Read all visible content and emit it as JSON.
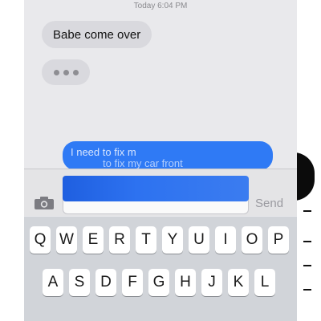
{
  "status": {
    "timestamp": "Today 6:04 PM"
  },
  "conversation": {
    "incoming_message": "Babe come over",
    "typing_indicator_icon": "ellipsis-typing-icon",
    "outgoing_line_1": "I need to fix m",
    "outgoing_line_2": "to fix my car front"
  },
  "composer": {
    "camera_icon": "camera-icon",
    "send_label": "Send"
  },
  "keyboard": {
    "row1": [
      "Q",
      "W",
      "E",
      "R",
      "T",
      "Y",
      "U",
      "I",
      "O",
      "P"
    ],
    "row2": [
      "A",
      "S",
      "D",
      "F",
      "G",
      "H",
      "J",
      "K",
      "L"
    ]
  },
  "colors": {
    "outgoing_bubble": "#2f7af5",
    "incoming_bubble": "#d9d9de",
    "keyboard_bg": "#d1d4d9"
  }
}
